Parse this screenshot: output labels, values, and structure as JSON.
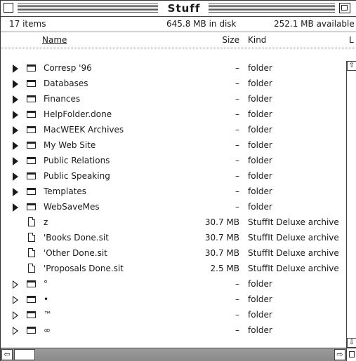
{
  "window": {
    "title": "Stuff"
  },
  "infobar": {
    "items": "17 items",
    "disk": "645.8 MB in disk",
    "available": "252.1 MB available"
  },
  "columns": {
    "name": "Name",
    "size": "Size",
    "kind": "Kind",
    "label": "L"
  },
  "rows": [
    {
      "name": "Corresp '96",
      "size": "–",
      "kind": "folder",
      "type": "folder",
      "icon": "folder-icon"
    },
    {
      "name": "Databases",
      "size": "–",
      "kind": "folder",
      "type": "folder",
      "icon": "folder-icon"
    },
    {
      "name": "Finances",
      "size": "–",
      "kind": "folder",
      "type": "folder",
      "icon": "folder-icon"
    },
    {
      "name": "HelpFolder.done",
      "size": "–",
      "kind": "folder",
      "type": "folder",
      "icon": "folder-icon"
    },
    {
      "name": "MacWEEK Archives",
      "size": "–",
      "kind": "folder",
      "type": "folder",
      "icon": "folder-icon"
    },
    {
      "name": "My Web Site",
      "size": "–",
      "kind": "folder",
      "type": "folder",
      "icon": "folder-icon"
    },
    {
      "name": "Public Relations",
      "size": "–",
      "kind": "folder",
      "type": "folder",
      "icon": "folder-icon"
    },
    {
      "name": "Public Speaking",
      "size": "–",
      "kind": "folder",
      "type": "folder",
      "icon": "folder-icon"
    },
    {
      "name": "Templates",
      "size": "–",
      "kind": "folder",
      "type": "folder",
      "icon": "folder-icon"
    },
    {
      "name": "WebSaveMes",
      "size": "–",
      "kind": "folder",
      "type": "folder",
      "icon": "folder-icon"
    },
    {
      "name": "z",
      "size": "30.7 MB",
      "kind": "StuffIt Deluxe archive",
      "type": "file",
      "icon": "document-icon"
    },
    {
      "name": "'Books Done.sit",
      "size": "30.7 MB",
      "kind": "StuffIt Deluxe archive",
      "type": "file",
      "icon": "document-icon"
    },
    {
      "name": "'Other Done.sit",
      "size": "30.7 MB",
      "kind": "StuffIt Deluxe archive",
      "type": "file",
      "icon": "document-icon"
    },
    {
      "name": "'Proposals Done.sit",
      "size": "2.5 MB",
      "kind": "StuffIt Deluxe archive",
      "type": "file",
      "icon": "document-icon"
    },
    {
      "name": "°",
      "size": "–",
      "kind": "folder",
      "type": "folder-hollow",
      "icon": "folder-icon"
    },
    {
      "name": "•",
      "size": "–",
      "kind": "folder",
      "type": "folder-hollow",
      "icon": "folder-icon"
    },
    {
      "name": "™",
      "size": "–",
      "kind": "folder",
      "type": "folder-hollow",
      "icon": "folder-icon"
    },
    {
      "name": "∞",
      "size": "–",
      "kind": "folder",
      "type": "folder-hollow",
      "icon": "folder-icon"
    }
  ],
  "icons": {
    "close": "close-box-icon",
    "zoom": "zoom-box-icon",
    "scroll_up": "arrow-up-icon",
    "scroll_down": "arrow-down-icon",
    "scroll_left": "arrow-left-icon",
    "scroll_right": "arrow-right-icon",
    "grow": "grow-box-icon"
  },
  "glyphs": {
    "up": "⇧",
    "down": "⇩",
    "left": "⇦",
    "right": "⇨"
  }
}
